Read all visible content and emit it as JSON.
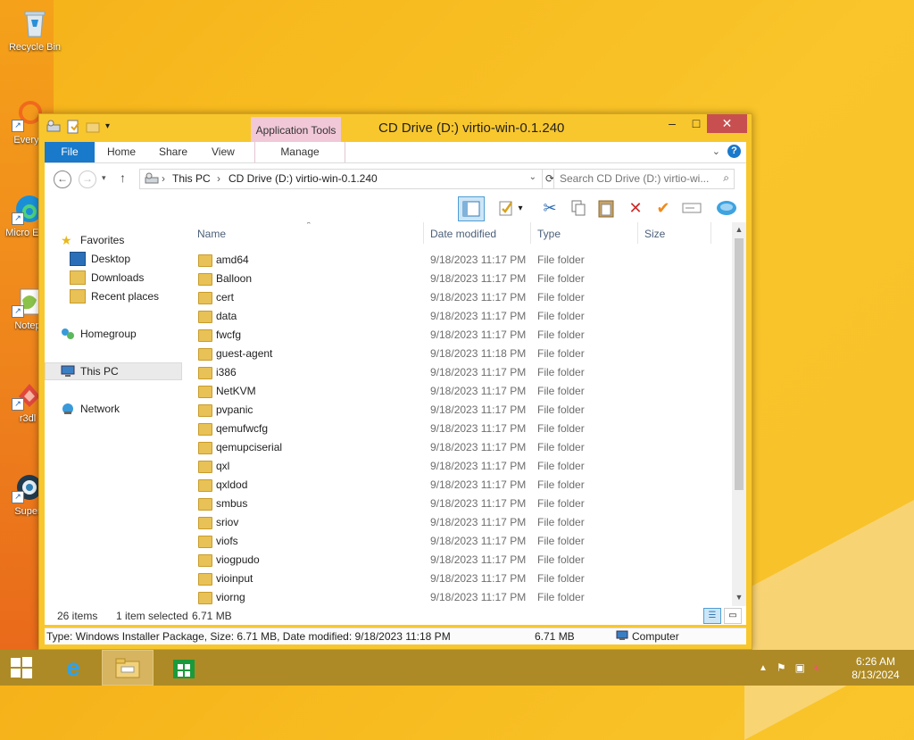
{
  "desktop": {
    "icons": [
      {
        "label": "Recycle Bin"
      },
      {
        "label": "Everyt"
      },
      {
        "label": "Micro Edg"
      },
      {
        "label": "Notep"
      },
      {
        "label": "r3dl"
      },
      {
        "label": "Super"
      }
    ]
  },
  "window": {
    "title": "CD Drive (D:) virtio-win-0.1.240",
    "context_tab_group": "Application Tools",
    "tabs": [
      "File",
      "Home",
      "Share",
      "View",
      "Manage"
    ],
    "help_glyph": "?",
    "minimize_glyph": "–",
    "maximize_glyph": "□",
    "close_glyph": "✕"
  },
  "address": {
    "back_glyph": "←",
    "forward_glyph": "→",
    "up_glyph": "↑",
    "crumbs": [
      "This PC",
      "CD Drive (D:) virtio-win-0.1.240"
    ],
    "separator": "›",
    "search_placeholder": "Search CD Drive (D:) virtio-wi..."
  },
  "navpane": {
    "favorites": "Favorites",
    "desktop": "Desktop",
    "downloads": "Downloads",
    "recent": "Recent places",
    "homegroup": "Homegroup",
    "thispc": "This PC",
    "network": "Network"
  },
  "columns": [
    "Name",
    "Date modified",
    "Type",
    "Size"
  ],
  "files": [
    {
      "name": "amd64",
      "date": "9/18/2023 11:17 PM",
      "type": "File folder"
    },
    {
      "name": "Balloon",
      "date": "9/18/2023 11:17 PM",
      "type": "File folder"
    },
    {
      "name": "cert",
      "date": "9/18/2023 11:17 PM",
      "type": "File folder"
    },
    {
      "name": "data",
      "date": "9/18/2023 11:17 PM",
      "type": "File folder"
    },
    {
      "name": "fwcfg",
      "date": "9/18/2023 11:17 PM",
      "type": "File folder"
    },
    {
      "name": "guest-agent",
      "date": "9/18/2023 11:18 PM",
      "type": "File folder"
    },
    {
      "name": "i386",
      "date": "9/18/2023 11:17 PM",
      "type": "File folder"
    },
    {
      "name": "NetKVM",
      "date": "9/18/2023 11:17 PM",
      "type": "File folder"
    },
    {
      "name": "pvpanic",
      "date": "9/18/2023 11:17 PM",
      "type": "File folder"
    },
    {
      "name": "qemufwcfg",
      "date": "9/18/2023 11:17 PM",
      "type": "File folder"
    },
    {
      "name": "qemupciserial",
      "date": "9/18/2023 11:17 PM",
      "type": "File folder"
    },
    {
      "name": "qxl",
      "date": "9/18/2023 11:17 PM",
      "type": "File folder"
    },
    {
      "name": "qxldod",
      "date": "9/18/2023 11:17 PM",
      "type": "File folder"
    },
    {
      "name": "smbus",
      "date": "9/18/2023 11:17 PM",
      "type": "File folder"
    },
    {
      "name": "sriov",
      "date": "9/18/2023 11:17 PM",
      "type": "File folder"
    },
    {
      "name": "viofs",
      "date": "9/18/2023 11:17 PM",
      "type": "File folder"
    },
    {
      "name": "viogpudo",
      "date": "9/18/2023 11:17 PM",
      "type": "File folder"
    },
    {
      "name": "vioinput",
      "date": "9/18/2023 11:17 PM",
      "type": "File folder"
    },
    {
      "name": "viorng",
      "date": "9/18/2023 11:17 PM",
      "type": "File folder"
    }
  ],
  "status": {
    "count": "26 items",
    "selection": "1 item selected",
    "size": "6.71 MB"
  },
  "details": {
    "text": "Type: Windows Installer Package, Size: 6.71 MB, Date modified: 9/18/2023 11:18 PM",
    "size": "6.71 MB",
    "location": "Computer"
  },
  "taskbar": {
    "time": "6:26 AM",
    "date": "8/13/2024"
  },
  "colors": {
    "accent": "#1979ca",
    "window_frame": "#f8c72d",
    "close_button": "#c74f4f",
    "context_tab": "#f1c8d8",
    "taskbar": "#ad8a25"
  }
}
